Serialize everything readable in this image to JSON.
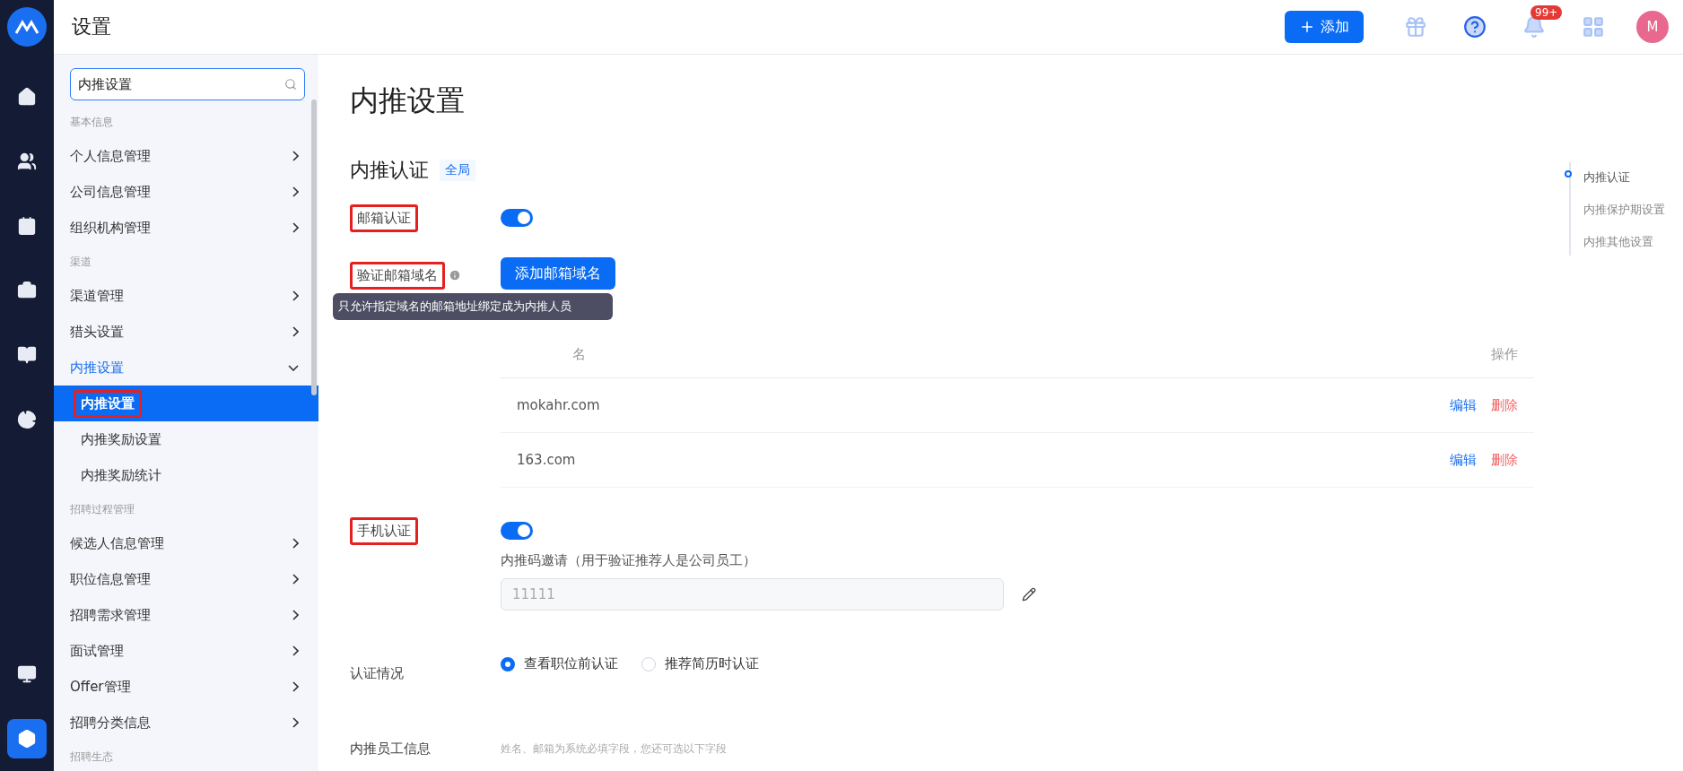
{
  "topbar": {
    "title": "设置",
    "add_button": "添加",
    "notification_badge": "99+",
    "avatar": "M"
  },
  "rail": [
    {
      "kind": "home",
      "selected": false
    },
    {
      "kind": "users",
      "selected": false
    },
    {
      "kind": "calendar",
      "selected": false
    },
    {
      "kind": "briefcase",
      "selected": false
    },
    {
      "kind": "book",
      "selected": false
    },
    {
      "kind": "chart",
      "selected": false
    },
    {
      "kind": "monitor",
      "selected": false
    },
    {
      "kind": "settings",
      "selected": true
    }
  ],
  "sidebar": {
    "search": {
      "value": "内推设置"
    },
    "groups": [
      {
        "label": "基本信息",
        "items": [
          {
            "label": "个人信息管理",
            "expanded": false
          },
          {
            "label": "公司信息管理",
            "expanded": false
          },
          {
            "label": "组织机构管理",
            "expanded": false
          }
        ]
      },
      {
        "label": "渠道",
        "items": [
          {
            "label": "渠道管理",
            "expanded": false
          },
          {
            "label": "猎头设置",
            "expanded": false
          },
          {
            "label": "内推设置",
            "expanded": true,
            "children": [
              {
                "label": "内推设置",
                "selected": true,
                "highlighted": true
              },
              {
                "label": "内推奖励设置",
                "selected": false,
                "highlighted": false
              },
              {
                "label": "内推奖励统计",
                "selected": false,
                "highlighted": false
              }
            ]
          }
        ]
      },
      {
        "label": "招聘过程管理",
        "items": [
          {
            "label": "候选人信息管理",
            "expanded": false
          },
          {
            "label": "职位信息管理",
            "expanded": false
          },
          {
            "label": "招聘需求管理",
            "expanded": false
          },
          {
            "label": "面试管理",
            "expanded": false
          },
          {
            "label": "Offer管理",
            "expanded": false
          },
          {
            "label": "招聘分类信息",
            "expanded": false
          }
        ]
      },
      {
        "label": "招聘生态"
      }
    ]
  },
  "page": {
    "title": "内推设置",
    "section": {
      "title": "内推认证",
      "tag": "全局"
    },
    "email_auth": {
      "label": "邮箱认证",
      "on": true,
      "highlighted": true
    },
    "domain": {
      "label": "验证邮箱域名",
      "highlighted": true,
      "button": "添加邮箱域名",
      "tooltip": "只允许指定域名的邮箱地址绑定成为内推人员",
      "table": {
        "columns": [
          "名",
          "操作"
        ],
        "rows": [
          {
            "domain": "mokahr.com",
            "actions": [
              "编辑",
              "删除"
            ]
          },
          {
            "domain": "163.com",
            "actions": [
              "编辑",
              "删除"
            ]
          }
        ]
      }
    },
    "phone_auth": {
      "label": "手机认证",
      "on": true,
      "highlighted": true,
      "code_label": "内推码邀请（用于验证推荐人是公司员工）",
      "code_value": "11111"
    },
    "auth_timing": {
      "label": "认证情况",
      "options": [
        {
          "label": "查看职位前认证",
          "selected": true
        },
        {
          "label": "推荐简历时认证",
          "selected": false
        }
      ]
    },
    "employee_info": {
      "label": "内推员工信息",
      "hint": "姓名、邮箱为系统必填字段，您还可选以下字段"
    }
  },
  "anchors": [
    {
      "label": "内推认证",
      "selected": true
    },
    {
      "label": "内推保护期设置",
      "selected": false
    },
    {
      "label": "内推其他设置",
      "selected": false
    }
  ]
}
